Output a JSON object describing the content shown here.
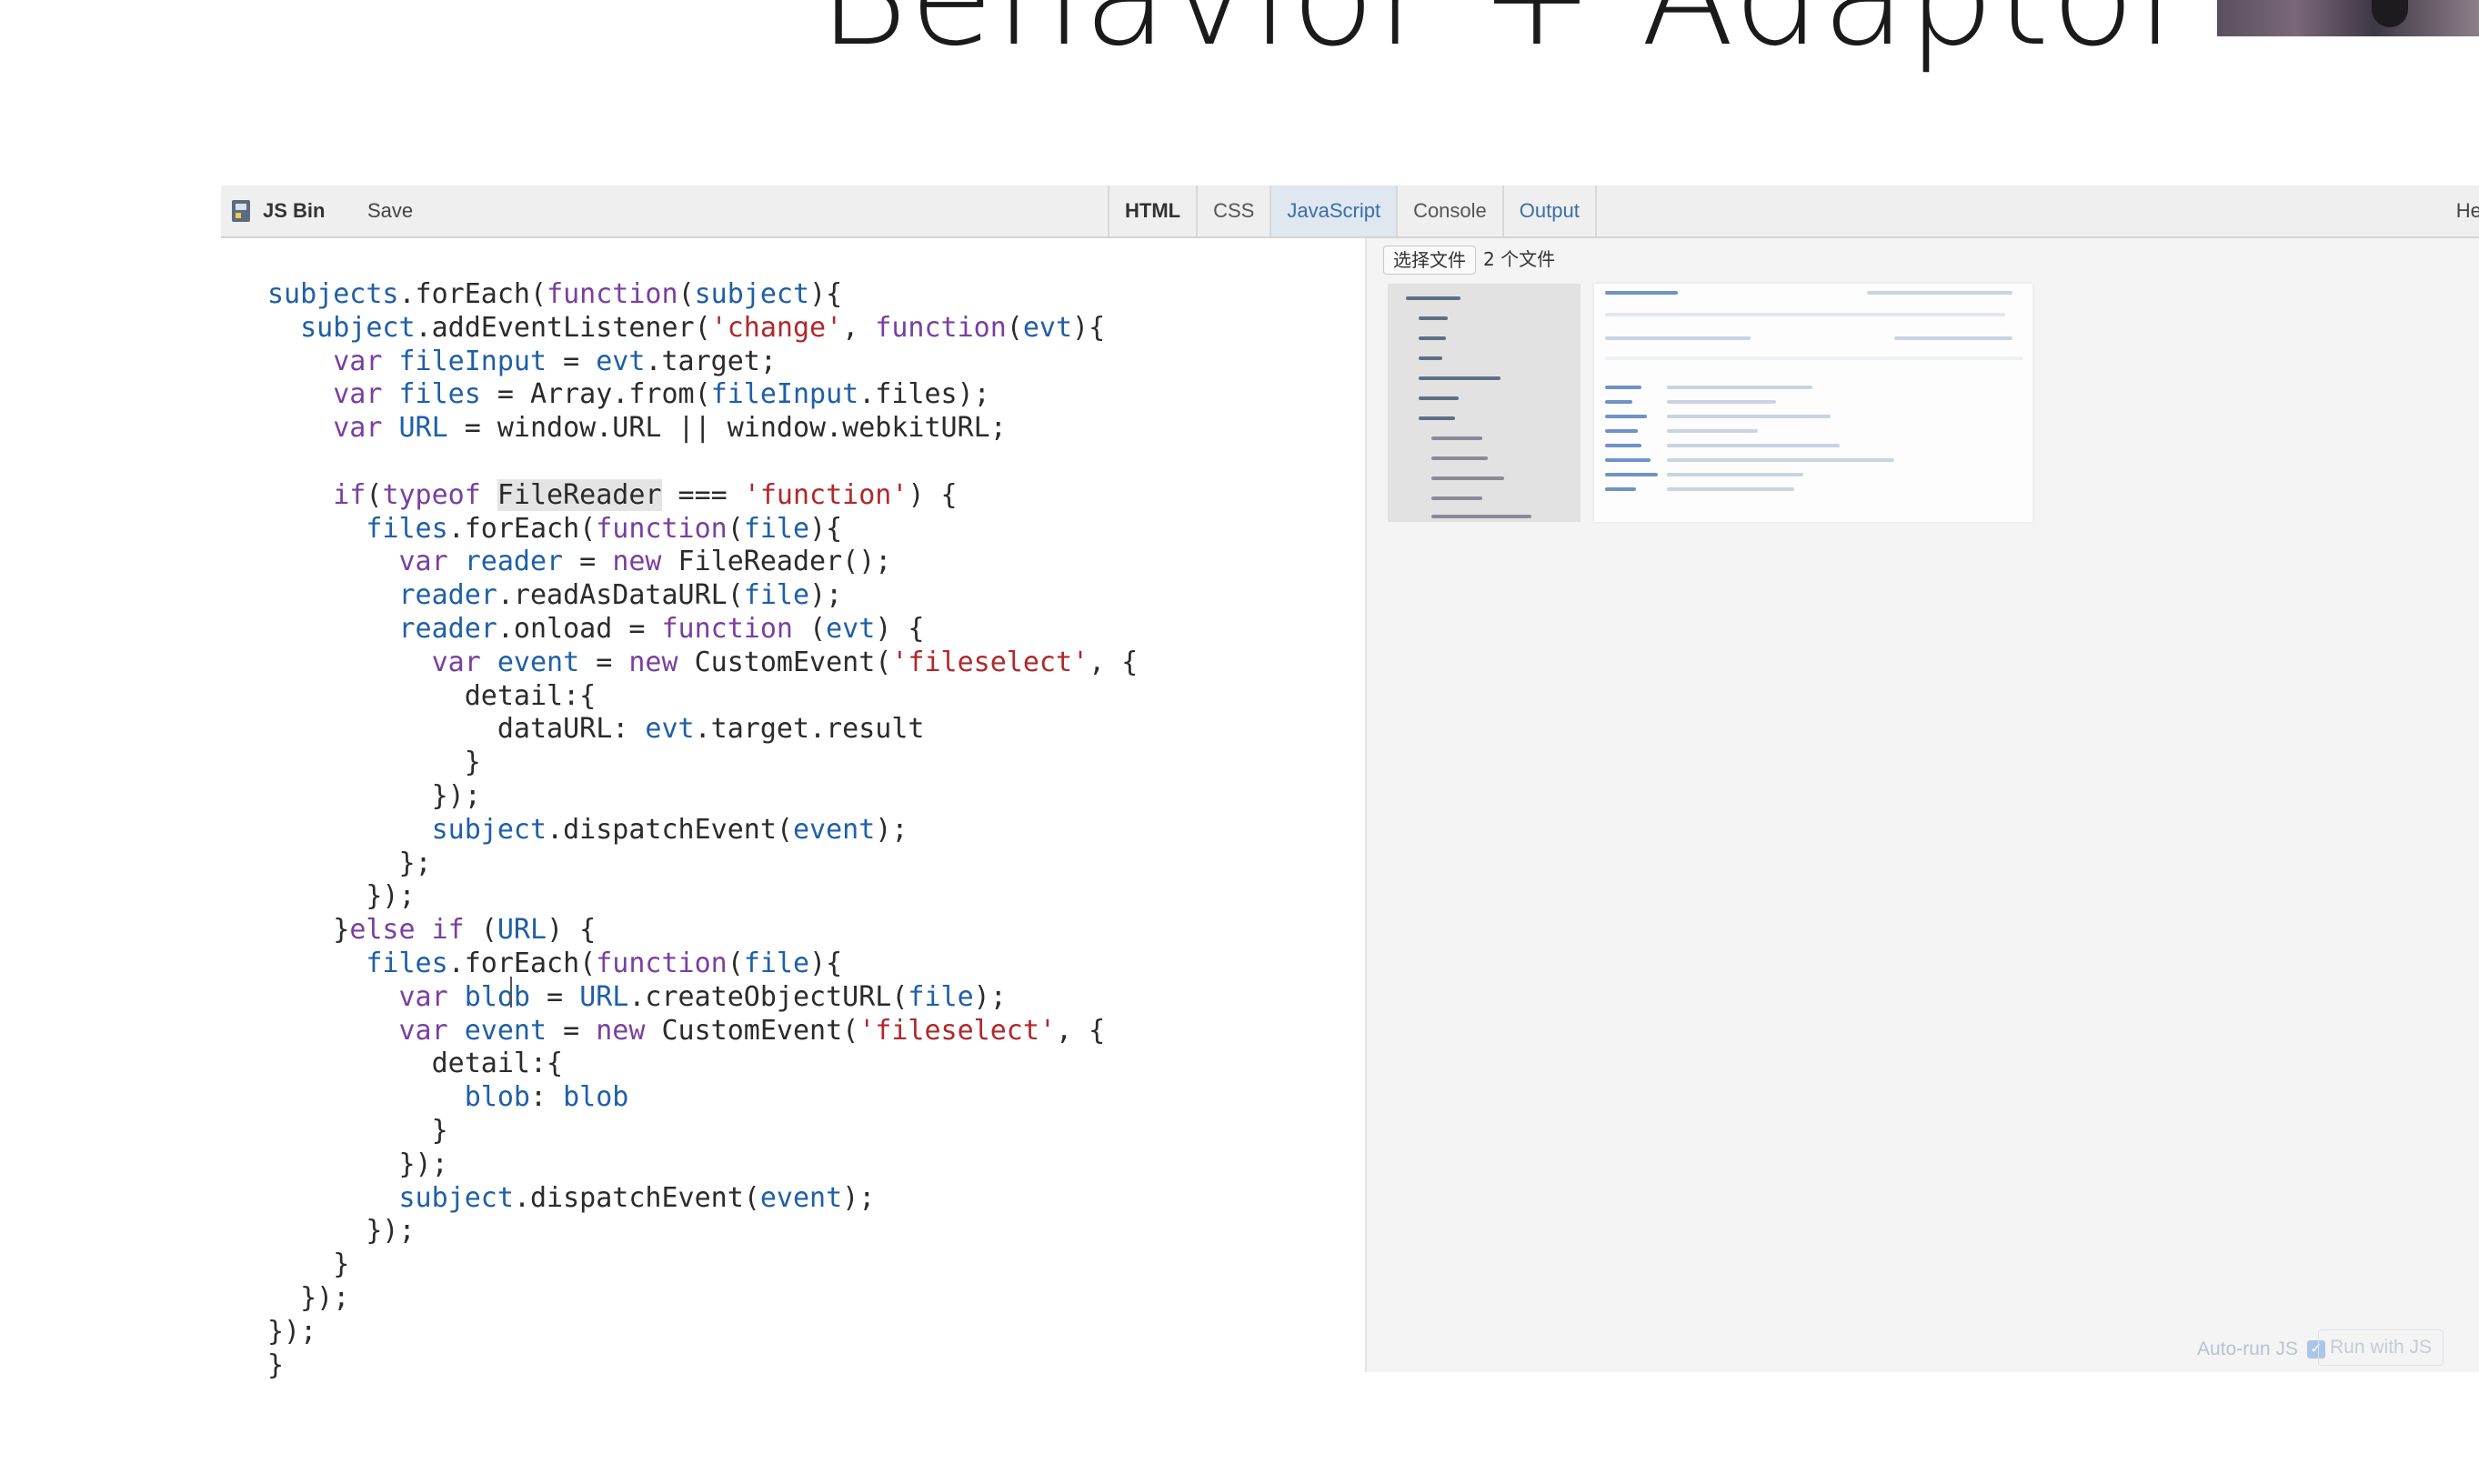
{
  "slide": {
    "title": "Behavior + Adaptor"
  },
  "toolbar": {
    "logo_label": "JS Bin",
    "save_label": "Save",
    "tabs": [
      "HTML",
      "CSS",
      "JavaScript",
      "Console",
      "Output"
    ],
    "active_tab": "JavaScript",
    "help_label": "Help"
  },
  "editor": {
    "language": "JavaScript",
    "code_lines": [
      "subjects.forEach(function(subject){",
      "  subject.addEventListener('change', function(evt){",
      "    var fileInput = evt.target;",
      "    var files = Array.from(fileInput.files);",
      "    var URL = window.URL || window.webkitURL;",
      "",
      "    if(typeof FileReader === 'function') {",
      "      files.forEach(function(file){",
      "        var reader = new FileReader();",
      "        reader.readAsDataURL(file);",
      "        reader.onload = function (evt) {",
      "          var event = new CustomEvent('fileselect', {",
      "            detail:{",
      "              dataURL: evt.target.result",
      "            }",
      "          });",
      "          subject.dispatchEvent(event);",
      "        };",
      "      });",
      "    }else if (URL) {",
      "      files.forEach(function(file){",
      "        var blob = URL.createObjectURL(file);",
      "        var event = new CustomEvent('fileselect', {",
      "          detail:{",
      "            blob: blob",
      "          }",
      "        });",
      "        subject.dispatchEvent(event);",
      "      });",
      "    }",
      "  });",
      "});",
      "}"
    ]
  },
  "output": {
    "file_button_label": "选择文件",
    "file_count_label": "2 个文件",
    "autorun_label": "Auto-run JS",
    "autorun_checked": true,
    "run_button_label": "Run with JS"
  },
  "colors": {
    "keyword": "#7a3fa0",
    "variable": "#1f5fa8",
    "string": "#b0282b",
    "active_tab_bg": "#dfe7f0",
    "toolbar_bg": "#efefef"
  }
}
